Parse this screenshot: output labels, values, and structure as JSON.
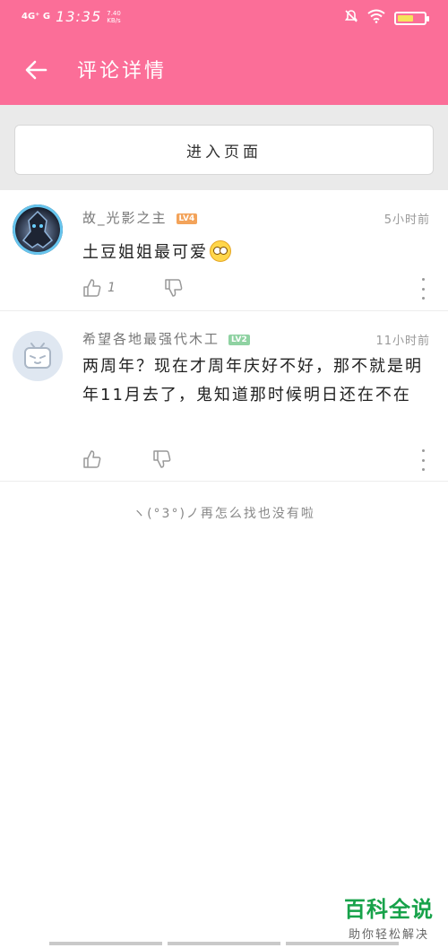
{
  "status_bar": {
    "network": "4G⁺ G",
    "time": "13:35",
    "speed": "7.40 KB/s",
    "battery_level": 0.6
  },
  "app_bar": {
    "title": "评论详情"
  },
  "enter_button": {
    "label": "进入页面"
  },
  "comments": [
    {
      "username": "故_光影之主",
      "level": "LV4",
      "time": "5小时前",
      "text": "土豆姐姐最可爱",
      "emoji": "flushed-face",
      "likes": "1"
    },
    {
      "username": "希望各地最强代木工",
      "level": "LV2",
      "time": "11小时前",
      "text": "两周年？现在才周年庆好不好，那不就是明年11月去了，鬼知道那时候明日还在不在",
      "likes": ""
    }
  ],
  "end_text": "ヽ(°3°)ノ再怎么找也没有啦",
  "watermark": {
    "title": "百科全说",
    "subtitle": "助你轻松解决"
  },
  "colors": {
    "primary": "#fb6e98",
    "watermark": "#17a24a",
    "lv4": "#f3a35a",
    "lv2": "#8fd2a2"
  }
}
